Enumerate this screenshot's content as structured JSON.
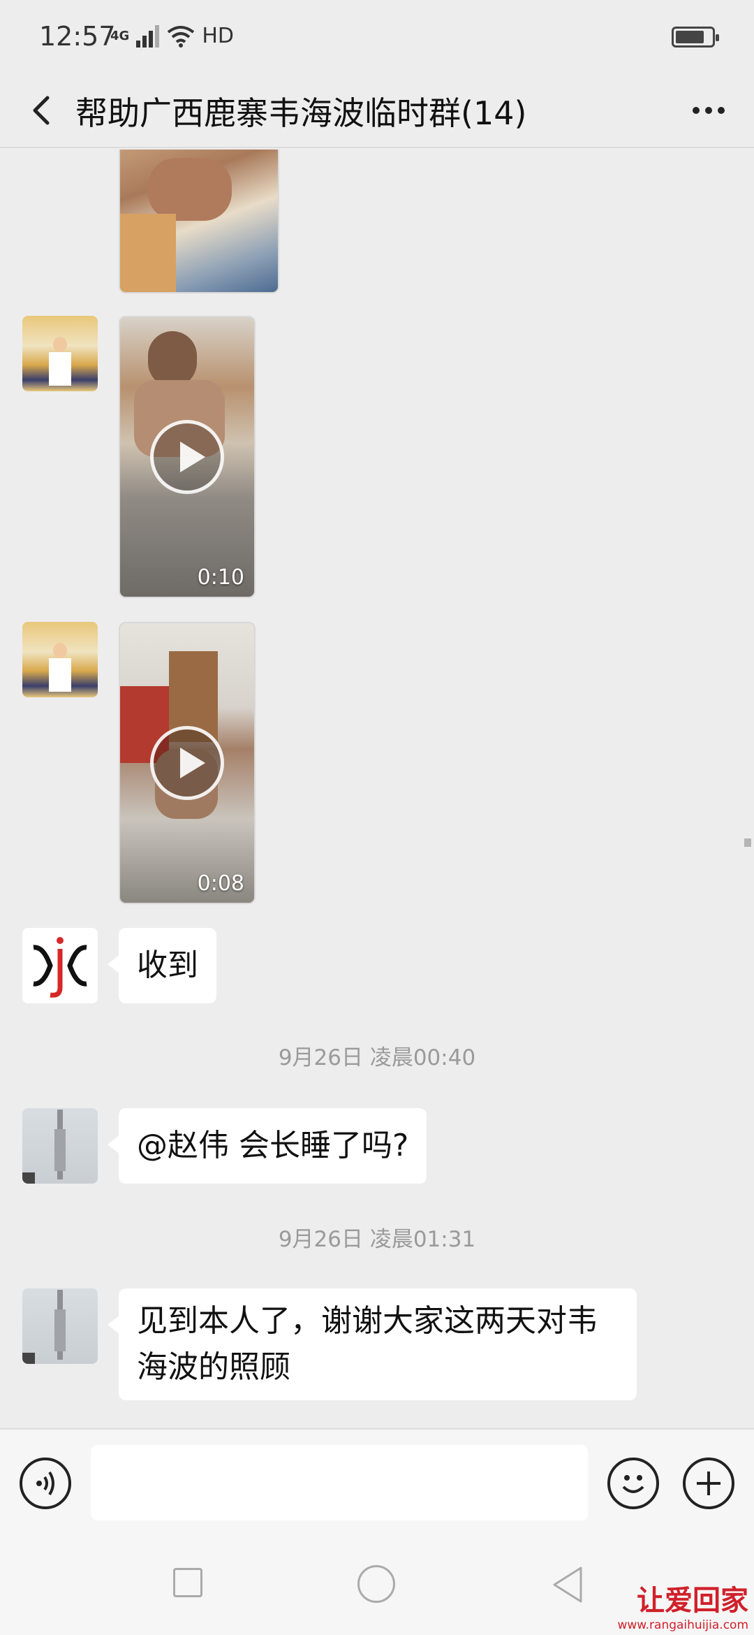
{
  "status_bar": {
    "time": "12:57",
    "network": "4G",
    "hd": "HD"
  },
  "header": {
    "title": "帮助广西鹿寨韦海波临时群(14)"
  },
  "messages": {
    "video1": {
      "duration": "0:10"
    },
    "video2": {
      "duration": "0:08"
    },
    "msg_received": {
      "text": "收到"
    },
    "timestamp1": "9月26日 凌晨00:40",
    "msg_mention": {
      "text": "@赵伟  会长睡了吗?"
    },
    "timestamp2": "9月26日 凌晨01:31",
    "msg_thanks": {
      "text": "见到本人了，谢谢大家这两天对韦海波的照顾"
    }
  },
  "watermark": {
    "title": "让爱回家",
    "url": "www.rangaihuijia.com"
  },
  "colors": {
    "background": "#ededed",
    "bubble": "#ffffff",
    "watermark_red": "#d0202a"
  }
}
